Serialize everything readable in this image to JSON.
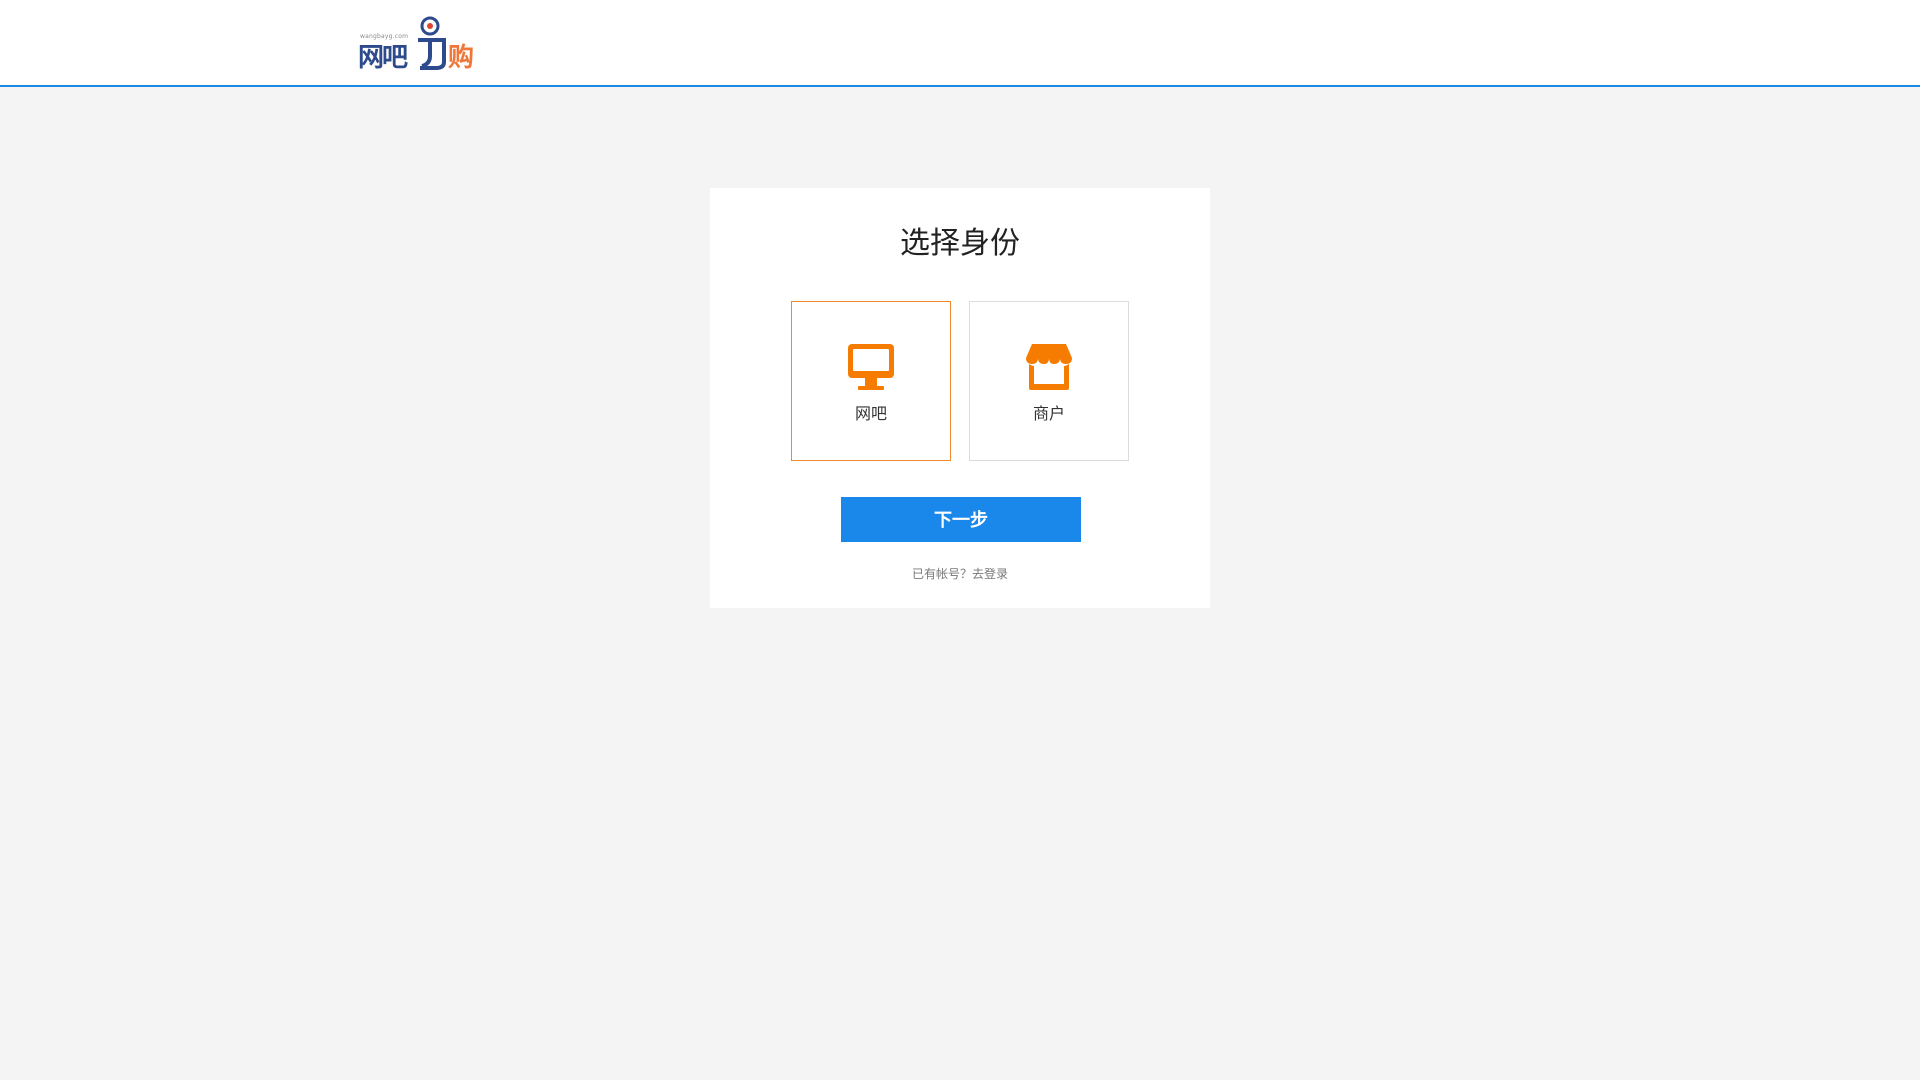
{
  "header": {
    "logo": {
      "url_text": "wangbayg.com",
      "name_part1": "网吧",
      "name_part2": "购"
    }
  },
  "card": {
    "title": "选择身份",
    "options": [
      {
        "label": "网吧",
        "icon": "monitor-icon",
        "selected": true
      },
      {
        "label": "商户",
        "icon": "shop-icon",
        "selected": false
      }
    ],
    "next_button": "下一步",
    "login_prompt": "已有帐号？",
    "login_link": "去登录"
  },
  "colors": {
    "accent_blue": "#1a88ea",
    "accent_orange": "#f57c00",
    "selected_border": "#f08a2e",
    "background": "#f4f4f4"
  }
}
